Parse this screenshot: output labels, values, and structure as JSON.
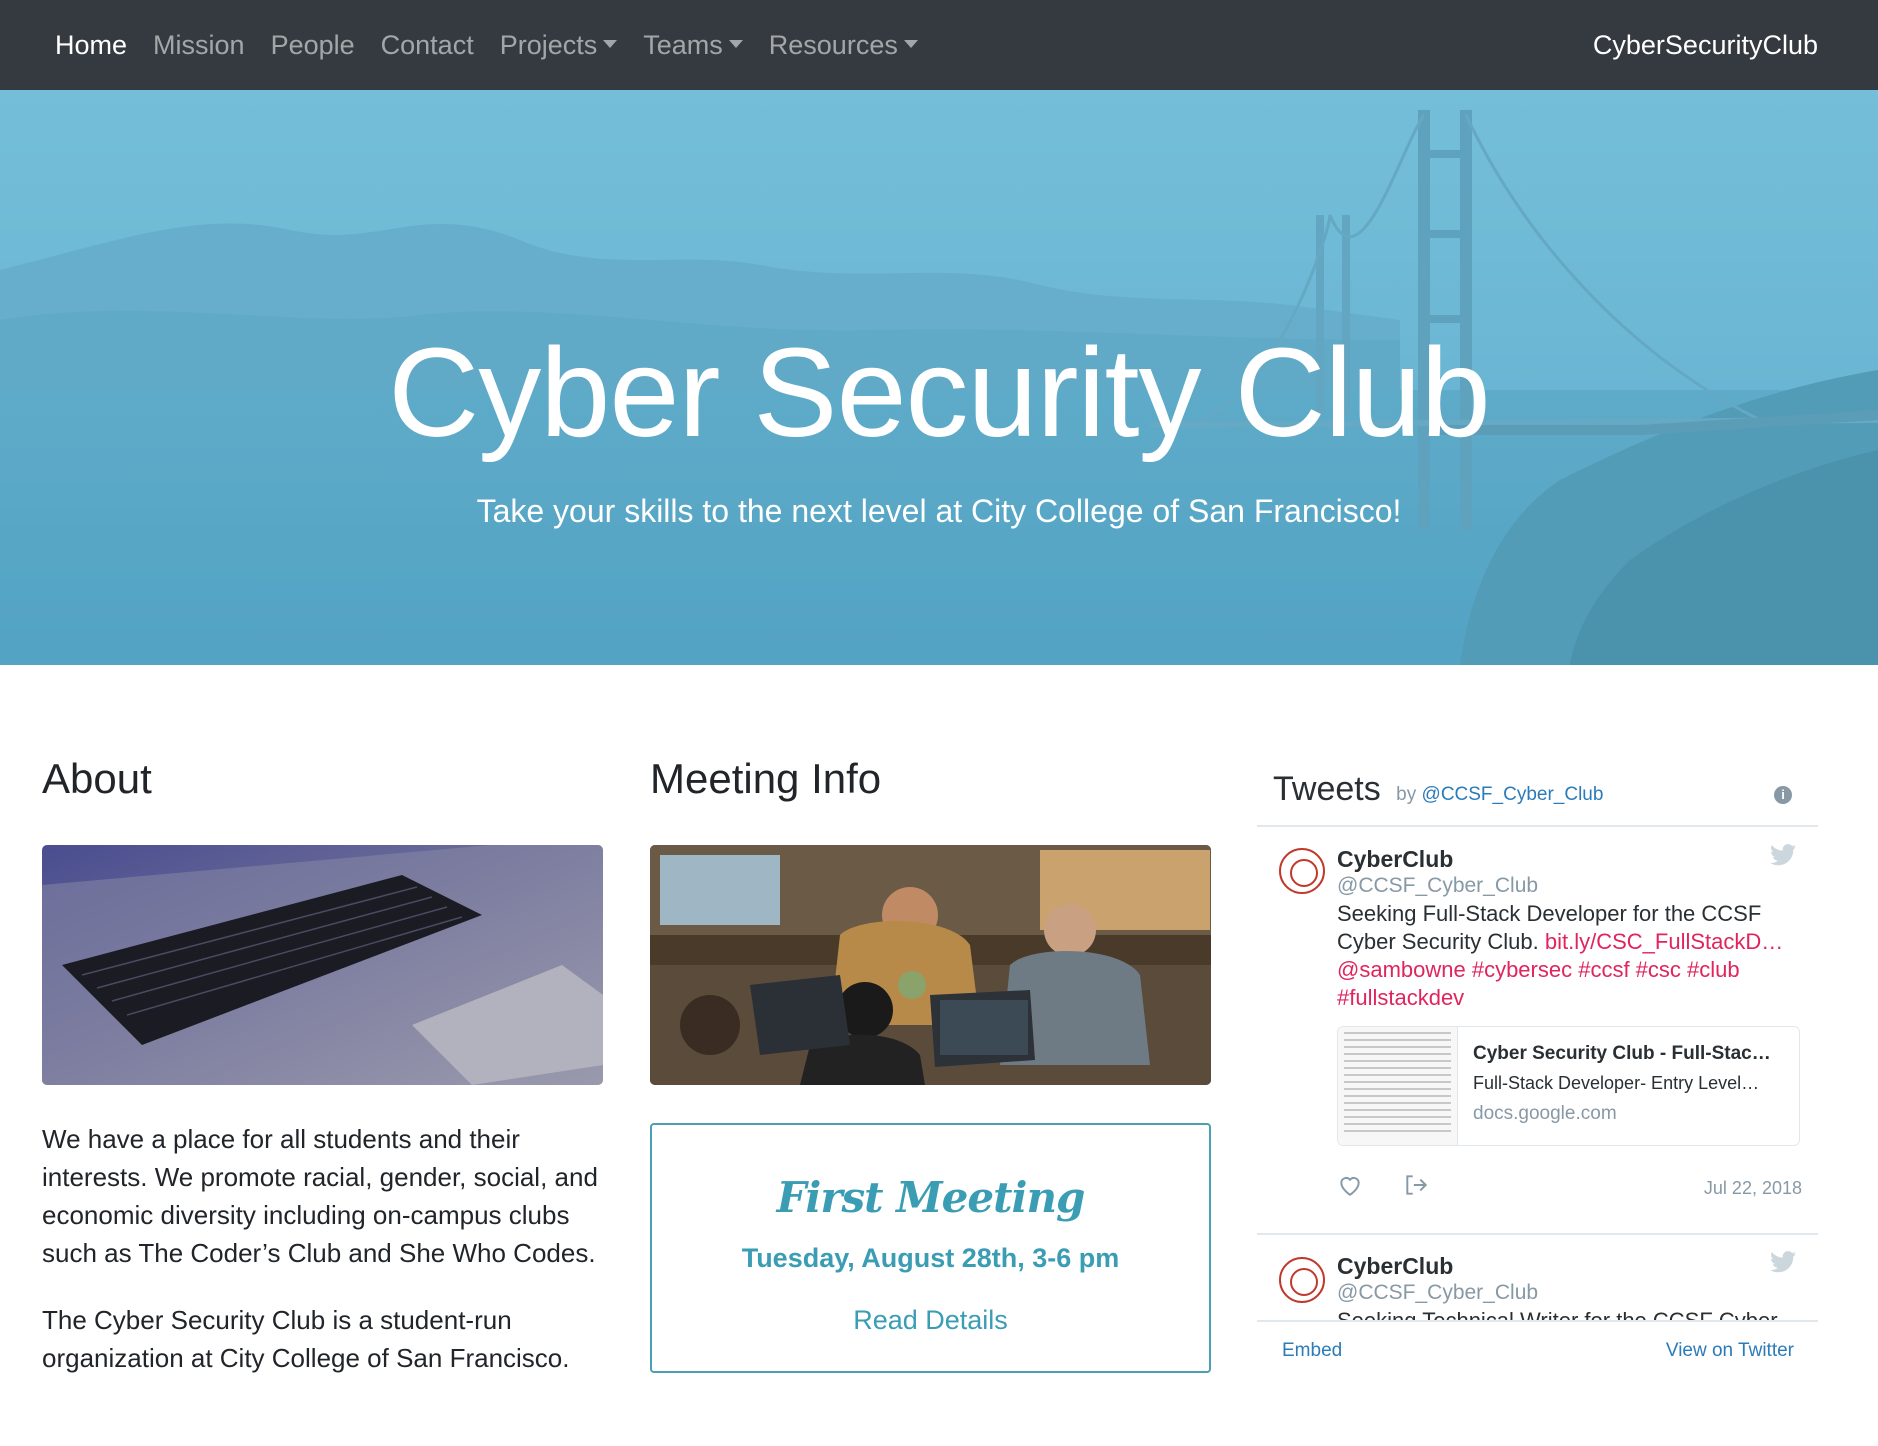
{
  "navbar": {
    "links": [
      "Home",
      "Mission",
      "People",
      "Contact",
      "Projects",
      "Teams",
      "Resources"
    ],
    "brand": "CyberSecurityClub"
  },
  "hero": {
    "title": "Cyber Security Club",
    "subtitle": "Take your skills to the next level at City College of San Francisco!"
  },
  "about": {
    "title": "About",
    "paragraph1": "We have a place for all students and their interests. We promote racial, gender, social, and economic diversity including on-campus clubs such as The Coder’s Club and She Who Codes.",
    "paragraph2": "The Cyber Security Club is a student-run organization at City College of San Francisco."
  },
  "meeting": {
    "title": "Meeting Info",
    "box_title": "First Meeting",
    "date": "Tuesday, August 28th, 3-6 pm",
    "link": "Read Details"
  },
  "tweets": {
    "heading": "Tweets",
    "by": "by",
    "by_handle": "@CCSF_Cyber_Club",
    "items": [
      {
        "name": "CyberClub",
        "handle": "@CCSF_Cyber_Club",
        "text": "Seeking Full-Stack Developer for the CCSF Cyber Security Club.",
        "link": "bit.ly/CSC_FullStackD…",
        "tags": "@sambowne #cybersec #ccsf #csc #club #fullstackdev",
        "card_title": "Cyber Security Club - Full-Stac…",
        "card_desc": "Full-Stack Developer- Entry Level…",
        "card_domain": "docs.google.com",
        "date": "Jul 22, 2018"
      },
      {
        "name": "CyberClub",
        "handle": "@CCSF_Cyber_Club",
        "text": "Seeking Technical Writer for the CCSF Cyber"
      }
    ],
    "embed": "Embed",
    "view_on_twitter": "View on Twitter"
  },
  "icons": {
    "info": "info-icon",
    "bird": "twitter-bird-icon",
    "heart": "heart-icon",
    "share": "share-icon",
    "avatar": "ccsf-seal-avatar"
  },
  "colors": {
    "navbar": "#343a40",
    "hero_tint": "#5fb0cf",
    "accent": "#3a9db4",
    "twitter_link": "#2b7bb9",
    "hashtag": "#e0245e"
  }
}
